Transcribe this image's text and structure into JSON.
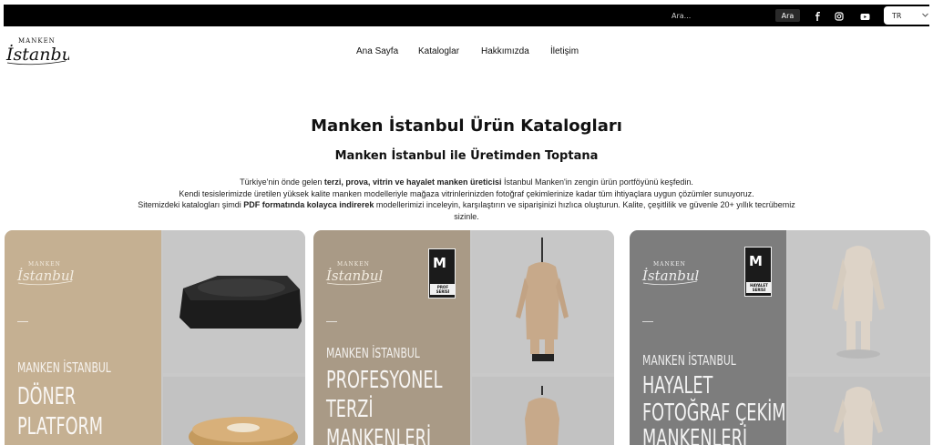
{
  "topbar": {
    "search_placeholder": "Ara...",
    "search_button": "Ara",
    "social_icons": [
      "facebook-icon",
      "instagram-icon",
      "youtube-icon"
    ],
    "language": "TR"
  },
  "nav": {
    "items": [
      "Ana Sayfa",
      "Kataloglar",
      "Hakkımızda",
      "İletişim"
    ]
  },
  "hero": {
    "title": "Manken İstanbul Ürün Katalogları",
    "subtitle": "Manken İstanbul ile Üretimden Toptana",
    "para1_a": "Türkiye'nin önde gelen ",
    "para1_b": "terzi, prova, vitrin ve hayalet manken üreticisi",
    "para1_c": " İstanbul Manken'in zengin ürün portföyünü keşfedin.",
    "para2": "Kendi tesislerimizde üretilen yüksek kalite manken modelleriyle mağaza vitrinlerinizden fotoğraf çekimlerinize kadar tüm ihtiyaçlara uygun çözümler sunuyoruz.",
    "para3_a": "Sitemizdeki katalogları şimdi ",
    "para3_b": "PDF formatında kolayca indirerek",
    "para3_c": " modellerimizi inceleyin, karşılaştırın ve siparişinizi hızlıca oluşturun. Kalite, çeşitlilik ve güvenle 20+ yıllık tecrübemiz sizinle."
  },
  "cards": [
    {
      "brand": "MANKEN İSTANBUL",
      "line1": "DÖNER",
      "line2": "PLATFORM",
      "bg": "#c5b092"
    },
    {
      "brand": "MANKEN İSTANBUL",
      "line1": "PROFESYONEL",
      "line2": "TERZİ",
      "line3": "MANKENLERİ",
      "badge_letter": "M",
      "badge_sub": "PROF SERİSİ",
      "bg": "#a99a86"
    },
    {
      "brand": "MANKEN İSTANBUL",
      "line1": "HAYALET",
      "line2": "FOTOĞRAF ÇEKİM",
      "line3": "MANKENLERİ",
      "badge_letter": "M",
      "badge_sub": "HAYALET SERİSİ",
      "bg": "#7d7d7d"
    }
  ],
  "colors": {
    "topbar": "#000000",
    "card_overlay": "#c9c9c9"
  }
}
